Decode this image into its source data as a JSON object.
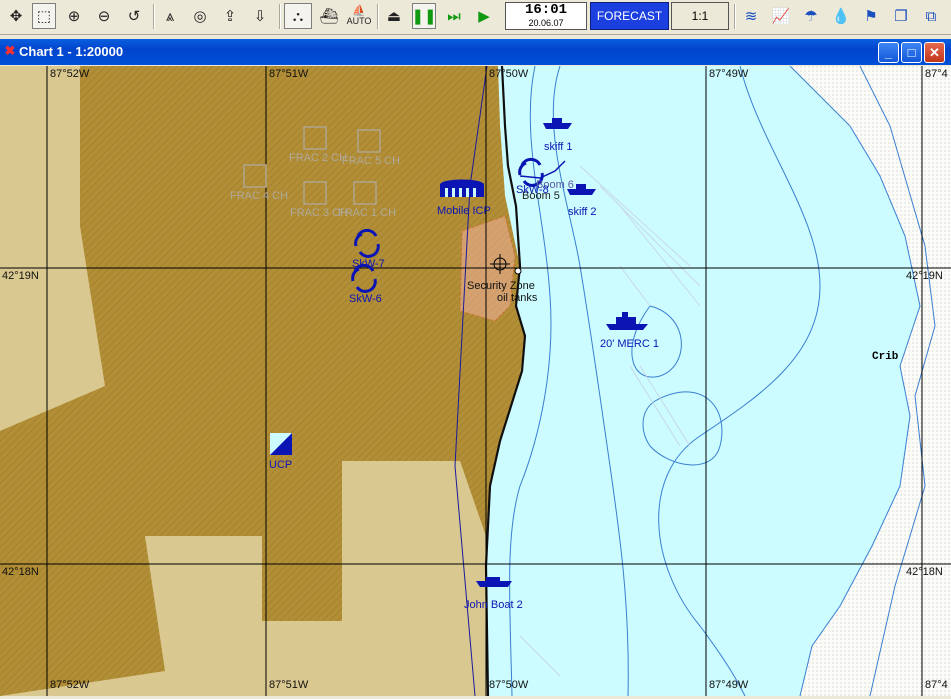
{
  "toolbar": {
    "auto_label": "AUTO",
    "clock": {
      "time": "16:01",
      "date": "20.06.07"
    },
    "forecast_label": "FORECAST",
    "scale_label": "1:1"
  },
  "window": {
    "title": "Chart 1 - 1:20000"
  },
  "map": {
    "longitudes_top": [
      "87°52W",
      "87°51W",
      "87°50W",
      "87°49W",
      "87°4"
    ],
    "longitudes_bottom": [
      "87°52W",
      "87°51W",
      "87°50W",
      "87°49W",
      "87°4"
    ],
    "latitudes": [
      "42°19N",
      "42°18N"
    ],
    "faded_labels": [
      "FRAC 2 CH",
      "FRAC 5 CH",
      "FRAC 4 CH",
      "FRAC 3 CH",
      "FRAC 1 CH"
    ],
    "objects": {
      "skiff1": "skiff 1",
      "skiff2": "skiff 2",
      "boom6": "Boom 6",
      "boom5": "Boom 5",
      "skw8": "SkW-8",
      "mobile_icp": "Mobile ICP",
      "skw7": "SkW-7",
      "skw6": "SkW-6",
      "security": "Security Zone",
      "oiltanks": "oil tanks",
      "merc": "20' MERC 1",
      "ucp": "UCP",
      "johnboat": "John Boat 2",
      "crib": "Crib"
    }
  }
}
